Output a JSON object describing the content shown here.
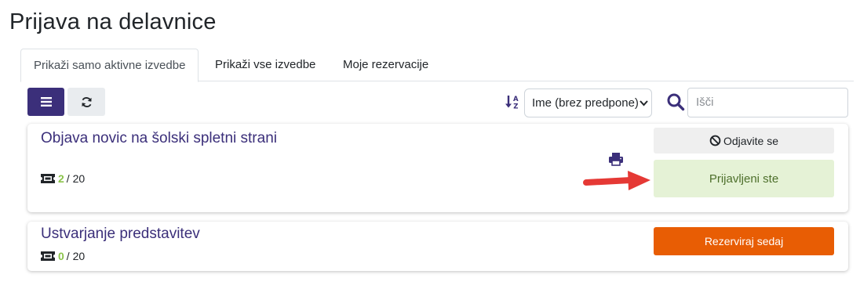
{
  "page": {
    "title": "Prijava na delavnice"
  },
  "tabs": [
    {
      "label": "Prikaži samo aktivne izvedbe",
      "active": true
    },
    {
      "label": "Prikaži vse izvedbe",
      "active": false
    },
    {
      "label": "Moje rezervacije",
      "active": false
    }
  ],
  "toolbar": {
    "menu_icon": "list-icon",
    "refresh_icon": "refresh-icon",
    "sort_icon": "sort-alpha-icon",
    "sort_value": "Ime (brez predpone)",
    "search_icon": "search-icon",
    "search_placeholder": "Išči"
  },
  "workshops": [
    {
      "title": "Objava novic na šolski spletni strani",
      "seats_taken": "2",
      "seats_sep": "/ 20",
      "cancel_label": "Odjavite se",
      "status_label": "Prijavljeni ste"
    },
    {
      "title": "Ustvarjanje predstavitev",
      "seats_taken": "0",
      "seats_sep": "/ 20",
      "reserve_label": "Rezerviraj sedaj"
    }
  ],
  "colors": {
    "primary": "#3b2f7a",
    "success_bg": "#e5f2d6",
    "success_text": "#4d6f2b",
    "reserve": "#e85d04",
    "seats_count": "#8bc34a",
    "annotation_arrow": "#e53935"
  }
}
